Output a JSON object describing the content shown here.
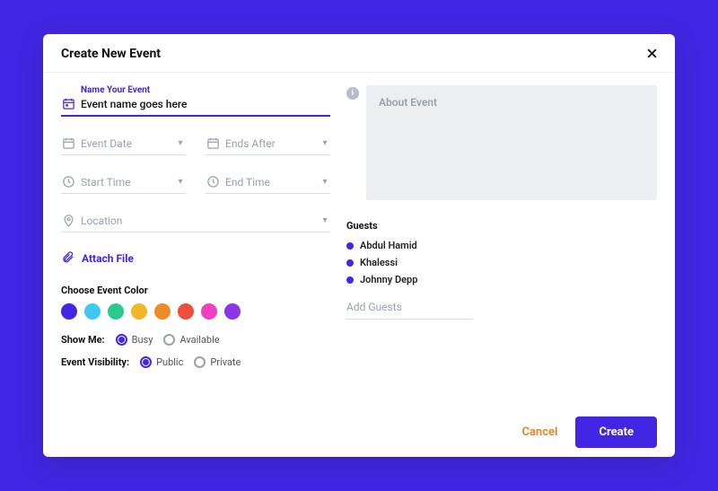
{
  "dialog": {
    "title": "Create New Event"
  },
  "event": {
    "name_label": "Name Your Event",
    "name_value": "Event name goes here",
    "date_placeholder": "Event Date",
    "ends_placeholder": "Ends After",
    "start_time_placeholder": "Start Time",
    "end_time_placeholder": "End Time",
    "location_placeholder": "Location",
    "attach_label": "Attach File"
  },
  "colors": {
    "label": "Choose Event Color",
    "options": [
      "#4326e3",
      "#3ec9f0",
      "#2bc98c",
      "#f0b728",
      "#f08a28",
      "#ef4e3a",
      "#f03fc3",
      "#8b35e8"
    ]
  },
  "show_me": {
    "label": "Show Me:",
    "busy": "Busy",
    "available": "Available",
    "selected": "busy"
  },
  "visibility": {
    "label": "Event Visibility:",
    "public": "Public",
    "private": "Private",
    "selected": "public"
  },
  "about": {
    "placeholder": "About Event"
  },
  "guests": {
    "label": "Guests",
    "list": [
      {
        "name": "Abdul Hamid"
      },
      {
        "name": "Khalessi"
      },
      {
        "name": "Johnny Depp"
      }
    ],
    "add_placeholder": "Add Guests"
  },
  "actions": {
    "cancel": "Cancel",
    "create": "Create"
  }
}
